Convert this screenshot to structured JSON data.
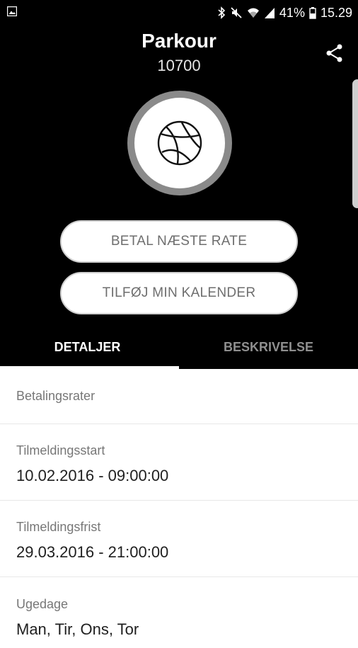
{
  "status_bar": {
    "battery": "41%",
    "time": "15.29",
    "icons": [
      "image-notification-icon",
      "bluetooth-icon",
      "mute-icon",
      "wifi-icon",
      "signal-icon",
      "battery-icon"
    ]
  },
  "header": {
    "title": "Parkour",
    "subtitle": "10700",
    "share_icon": "share-icon",
    "avatar_icon": "basketball-icon"
  },
  "actions": {
    "pay_next_rate": "BETAL NÆSTE RATE",
    "add_calendar": "TILFØJ MIN KALENDER"
  },
  "tabs": [
    {
      "label": "DETALJER",
      "active": true
    },
    {
      "label": "BESKRIVELSE",
      "active": false
    }
  ],
  "details": [
    {
      "label": "Betalingsrater",
      "value": ""
    },
    {
      "label": "Tilmeldingsstart",
      "value": "10.02.2016 - 09:00:00"
    },
    {
      "label": "Tilmeldingsfrist",
      "value": "29.03.2016 - 21:00:00"
    },
    {
      "label": "Ugedage",
      "value": "Man, Tir, Ons, Tor"
    }
  ],
  "colors": {
    "header_bg": "#000000",
    "content_bg": "#ffffff",
    "button_text": "#6e6e6e",
    "inactive_tab": "#8f8f8f"
  }
}
